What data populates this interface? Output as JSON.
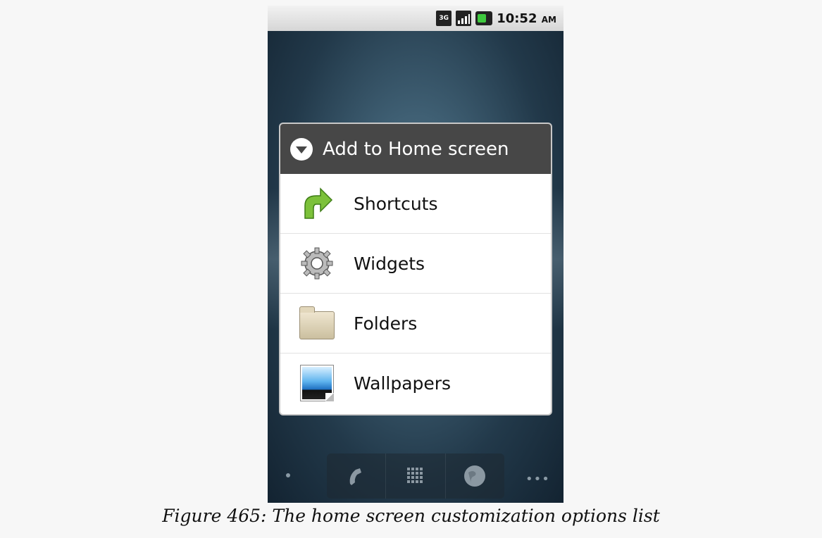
{
  "status_bar": {
    "network_label": "3G",
    "time": "10:52",
    "ampm": "AM"
  },
  "dialog": {
    "title": "Add to Home screen",
    "options": [
      {
        "label": "Shortcuts",
        "icon": "shortcut-arrow-icon"
      },
      {
        "label": "Widgets",
        "icon": "gear-icon"
      },
      {
        "label": "Folders",
        "icon": "folder-icon"
      },
      {
        "label": "Wallpapers",
        "icon": "wallpaper-icon"
      }
    ]
  },
  "dock": {
    "items": [
      "phone-icon",
      "app-drawer-icon",
      "browser-icon"
    ]
  },
  "caption": "Figure 465: The home screen customization options list"
}
